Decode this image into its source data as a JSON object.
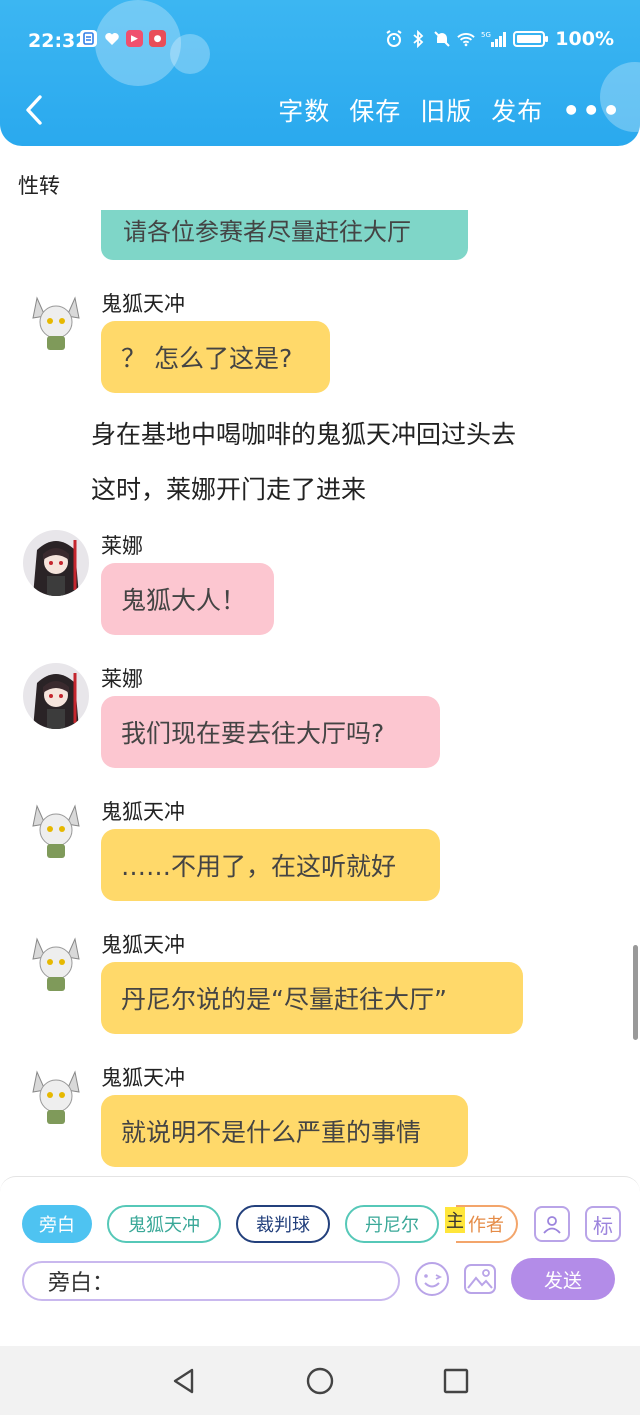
{
  "status_bar": {
    "time": "22:32",
    "battery": "100%",
    "network": "5G",
    "apps": [
      {
        "icon": "doc-app-icon",
        "color": "#2f7de6"
      },
      {
        "icon": "heart-app-icon",
        "color": "#2f7de6"
      },
      {
        "icon": "video-app-icon",
        "color": "#f0506e"
      },
      {
        "icon": "news-app-icon",
        "color": "#e94e59"
      }
    ]
  },
  "nav": {
    "back_icon": "chevron-left-icon",
    "word_count": "字数",
    "save": "保存",
    "old_version": "旧版",
    "publish": "发布",
    "more": "•••"
  },
  "story": {
    "title": "性转"
  },
  "messages": {
    "clipped": {
      "text": "请各位参赛者尽量赶往大厅",
      "color": "#7fd6c8"
    },
    "m1": {
      "speaker": "鬼狐天冲",
      "text": "？ 怎么了这是?"
    },
    "narration1": "身在基地中喝咖啡的鬼狐天冲回过头去",
    "narration2": "这时，莱娜开门走了进来",
    "m2": {
      "speaker": "莱娜",
      "text": "鬼狐大人！"
    },
    "m3": {
      "speaker": "莱娜",
      "text": "我们现在要去往大厅吗?"
    },
    "m4": {
      "speaker": "鬼狐天冲",
      "text": "……不用了，在这听就好"
    },
    "m5": {
      "speaker": "鬼狐天冲",
      "text": "丹尼尔说的是“尽量赶往大厅”"
    },
    "m6": {
      "speaker": "鬼狐天冲",
      "text": "就说明不是什么严重的事情"
    }
  },
  "composer": {
    "roles": {
      "narrator": "旁白",
      "guihu": "鬼狐天冲",
      "referee": "裁判球",
      "daniel": "丹尼尔",
      "master_badge": "主",
      "author": "作者"
    },
    "role_icon_label": "标",
    "input_prefix": "旁白：",
    "input_value": "",
    "send": "发送"
  },
  "colors": {
    "header": "#2aa9ee",
    "yellow_bubble": "#ffd96a",
    "pink_bubble": "#fcc6d0",
    "send": "#b38ce8"
  }
}
